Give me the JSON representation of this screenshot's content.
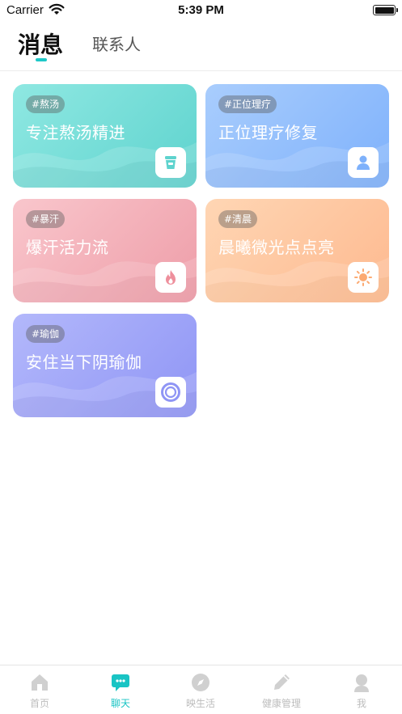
{
  "status_bar": {
    "carrier": "Carrier",
    "time": "5:39 PM"
  },
  "header": {
    "tabs": [
      {
        "label": "消息",
        "active": true
      },
      {
        "label": "联系人",
        "active": false
      }
    ]
  },
  "cards": [
    {
      "tag": "#熬汤",
      "title": "专注熬汤精进",
      "icon": "cup-icon",
      "color": "#6fdcd6"
    },
    {
      "tag": "#正位理疗",
      "title": "正位理疗修复",
      "icon": "person-icon",
      "color": "#8fbdfc"
    },
    {
      "tag": "#暴汗",
      "title": "爆汗活力流",
      "icon": "flame-icon",
      "color": "#f3aeb7"
    },
    {
      "tag": "#清晨",
      "title": "晨曦微光点点亮",
      "icon": "sun-icon",
      "color": "#fec8a0"
    },
    {
      "tag": "#瑜伽",
      "title": "安住当下阴瑜伽",
      "icon": "ring-icon",
      "color": "#a0a5f8"
    }
  ],
  "tabbar": {
    "items": [
      {
        "label": "首页",
        "icon": "home-icon"
      },
      {
        "label": "聊天",
        "icon": "chat-icon",
        "active": true
      },
      {
        "label": "映生活",
        "icon": "compass-icon"
      },
      {
        "label": "健康管理",
        "icon": "pencil-icon"
      },
      {
        "label": "我",
        "icon": "user-icon"
      }
    ]
  },
  "colors": {
    "accent": "#19c4c4",
    "inactive": "#bdbdbd"
  }
}
